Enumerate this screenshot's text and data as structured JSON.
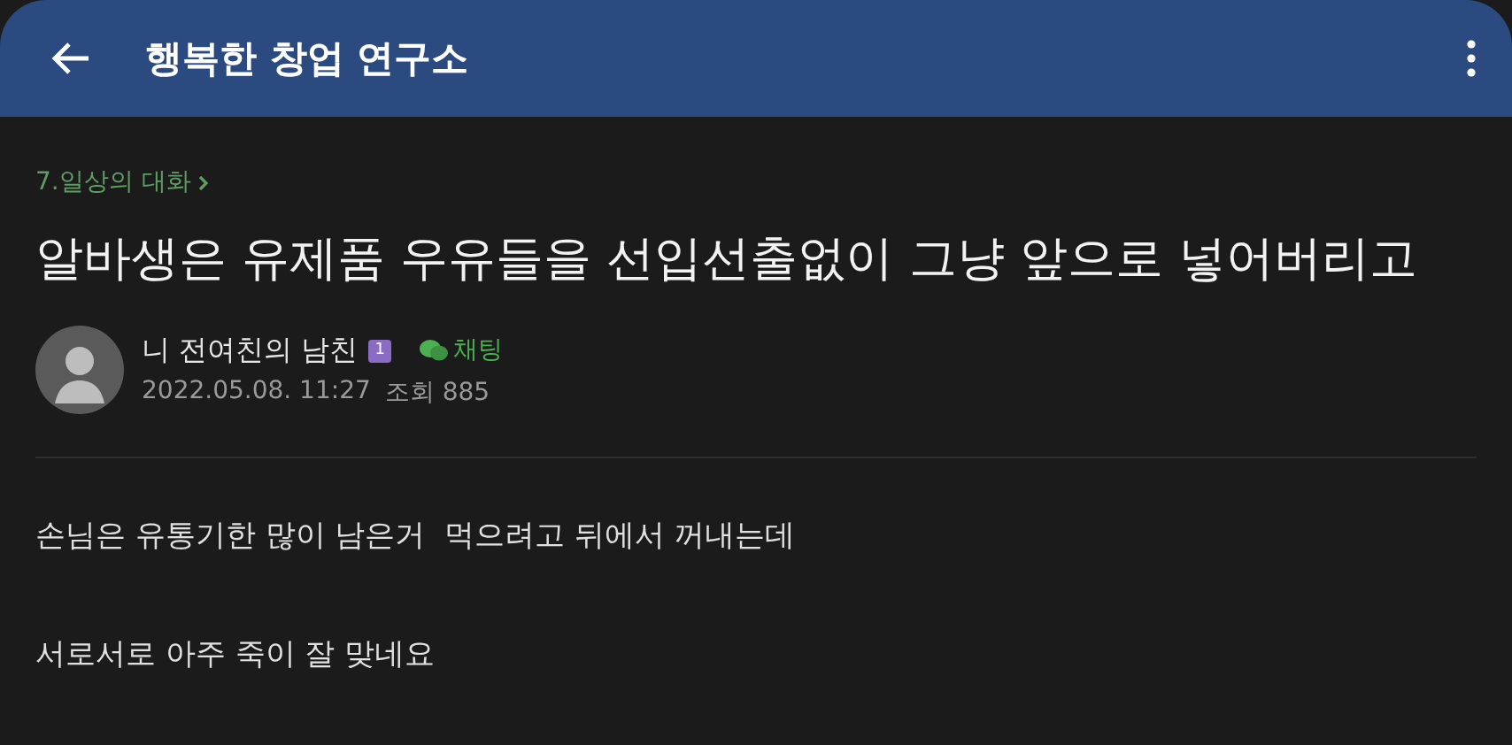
{
  "header": {
    "title": "행복한 창업 연구소"
  },
  "post": {
    "category": "7.일상의 대화",
    "title": "알바생은 유제품 우유들을 선입선출없이 그냥 앞으로 넣어버리고",
    "author": {
      "name": "니 전여친의 남친",
      "badge": "1",
      "chat": "채팅"
    },
    "date": "2022.05.08. 11:27",
    "views": "조회 885",
    "body": [
      "손님은 유통기한 많이 남은거  먹으려고 뒤에서 꺼내는데",
      "서로서로 아주 죽이 잘 맞네요"
    ]
  }
}
